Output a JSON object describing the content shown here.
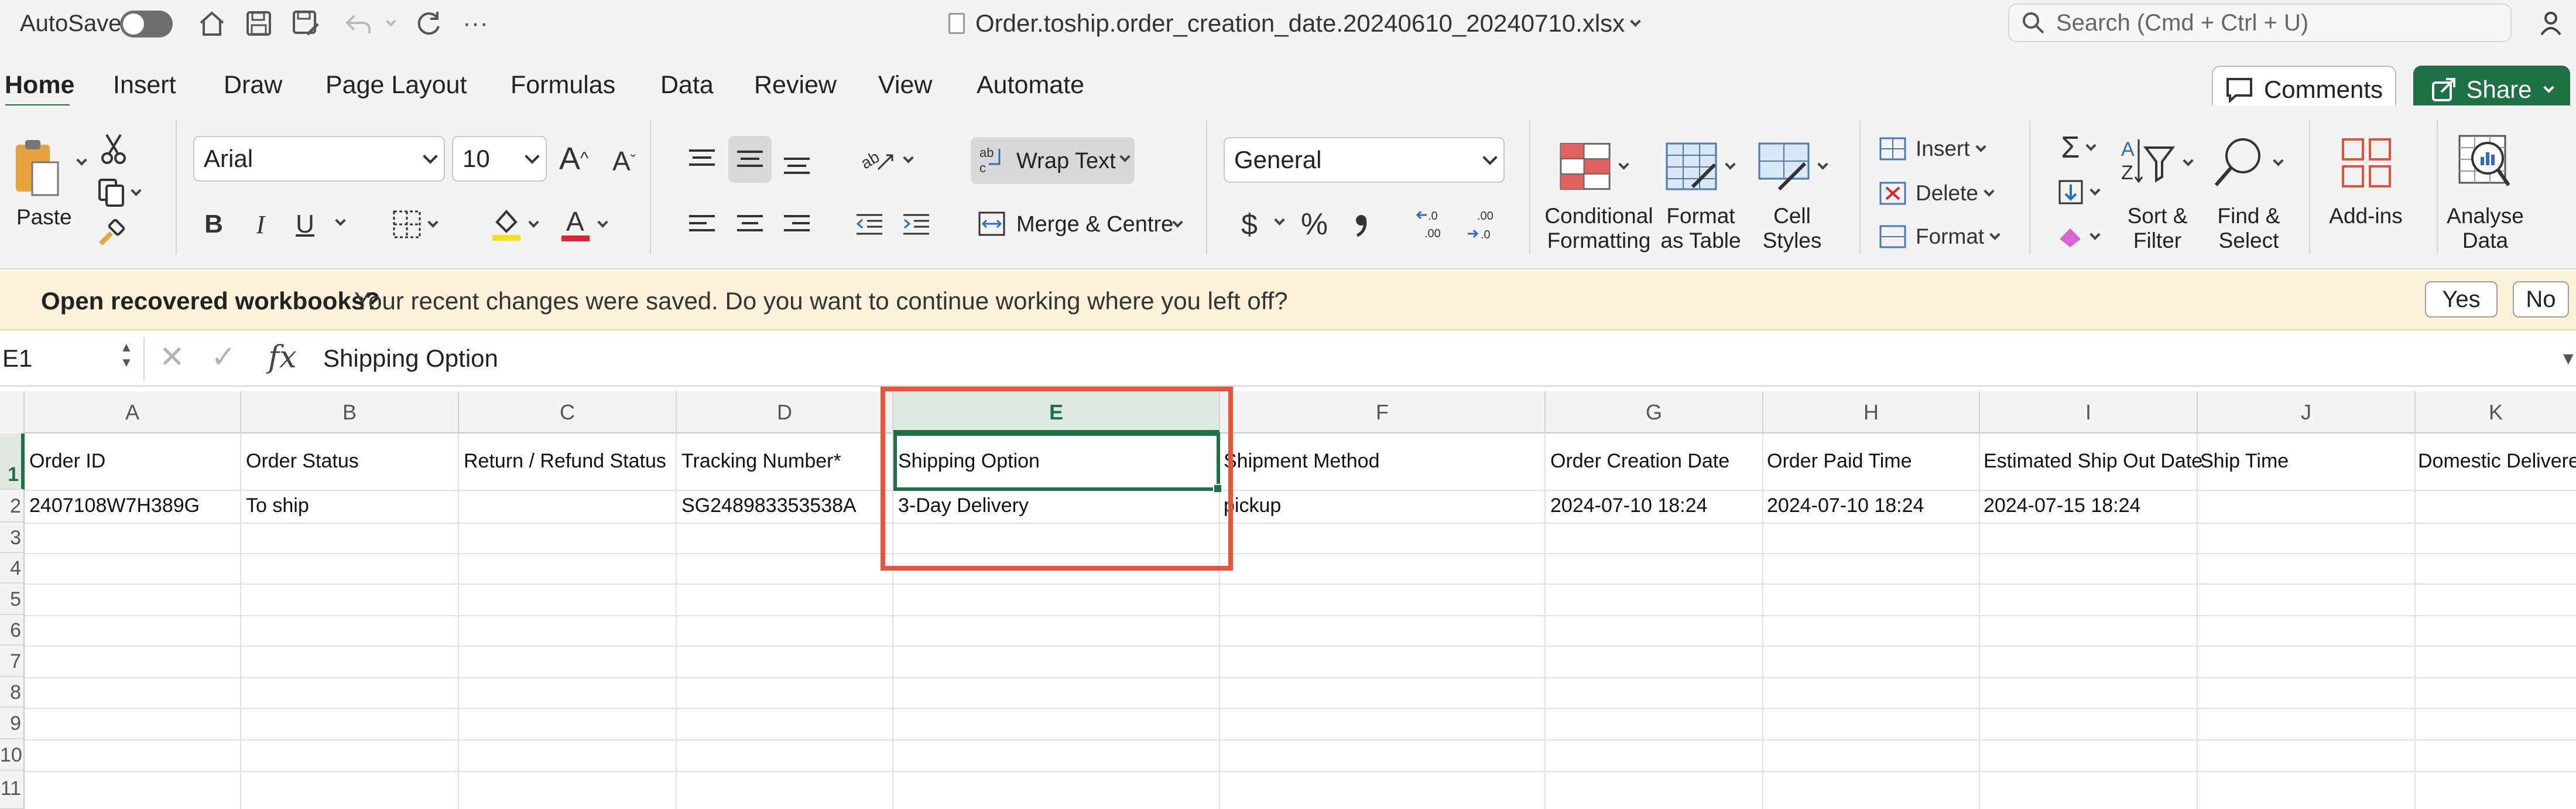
{
  "titlebar": {
    "autosave_label": "AutoSave",
    "file_title": "Order.toship.order_creation_date.20240610_20240710.xlsx",
    "search_placeholder": "Search (Cmd + Ctrl + U)"
  },
  "tabs": [
    "Home",
    "Insert",
    "Draw",
    "Page Layout",
    "Formulas",
    "Data",
    "Review",
    "View",
    "Automate"
  ],
  "header_buttons": {
    "comments": "Comments",
    "share": "Share"
  },
  "ribbon": {
    "paste": "Paste",
    "font_name": "Arial",
    "font_size": "10",
    "wrap_text": "Wrap Text",
    "merge_centre": "Merge & Centre",
    "number_format": "General",
    "conditional_formatting": [
      "Conditional",
      "Formatting"
    ],
    "format_as_table": [
      "Format",
      "as Table"
    ],
    "cell_styles": [
      "Cell",
      "Styles"
    ],
    "insert": "Insert",
    "delete": "Delete",
    "format": "Format",
    "sort_filter": [
      "Sort &",
      "Filter"
    ],
    "find_select": [
      "Find &",
      "Select"
    ],
    "add_ins": "Add-ins",
    "analyse_data": [
      "Analyse",
      "Data"
    ],
    "bold": "B",
    "italic": "I",
    "underline": "U",
    "currency": "$",
    "percent": "%"
  },
  "notification": {
    "title": "Open recovered workbooks?",
    "message": "Your recent changes were saved. Do you want to continue working where you left off?",
    "yes": "Yes",
    "no": "No"
  },
  "formula_bar": {
    "name_box": "E1",
    "fx": "fx",
    "content": "Shipping Option"
  },
  "sheet": {
    "columns": [
      "A",
      "B",
      "C",
      "D",
      "E",
      "F",
      "G",
      "H",
      "I",
      "J",
      "K"
    ],
    "rows": [
      "1",
      "2",
      "3",
      "4",
      "5",
      "6",
      "7",
      "8",
      "9",
      "10",
      "11"
    ],
    "headers": [
      "Order ID",
      "Order Status",
      "Return / Refund Status",
      "Tracking Number*",
      "Shipping Option",
      "Shipment Method",
      "Order Creation Date",
      "Order Paid Time",
      "Estimated Ship Out Date",
      "Ship Time",
      "Domestic Delivered"
    ],
    "row2": [
      "2407108W7H389G",
      "To ship",
      "",
      "SG248983353538A",
      "3-Day Delivery",
      "pickup",
      "2024-07-10 18:24",
      "2024-07-10 18:24",
      "2024-07-15 18:24",
      "",
      ""
    ],
    "selected_cell": "E1"
  }
}
